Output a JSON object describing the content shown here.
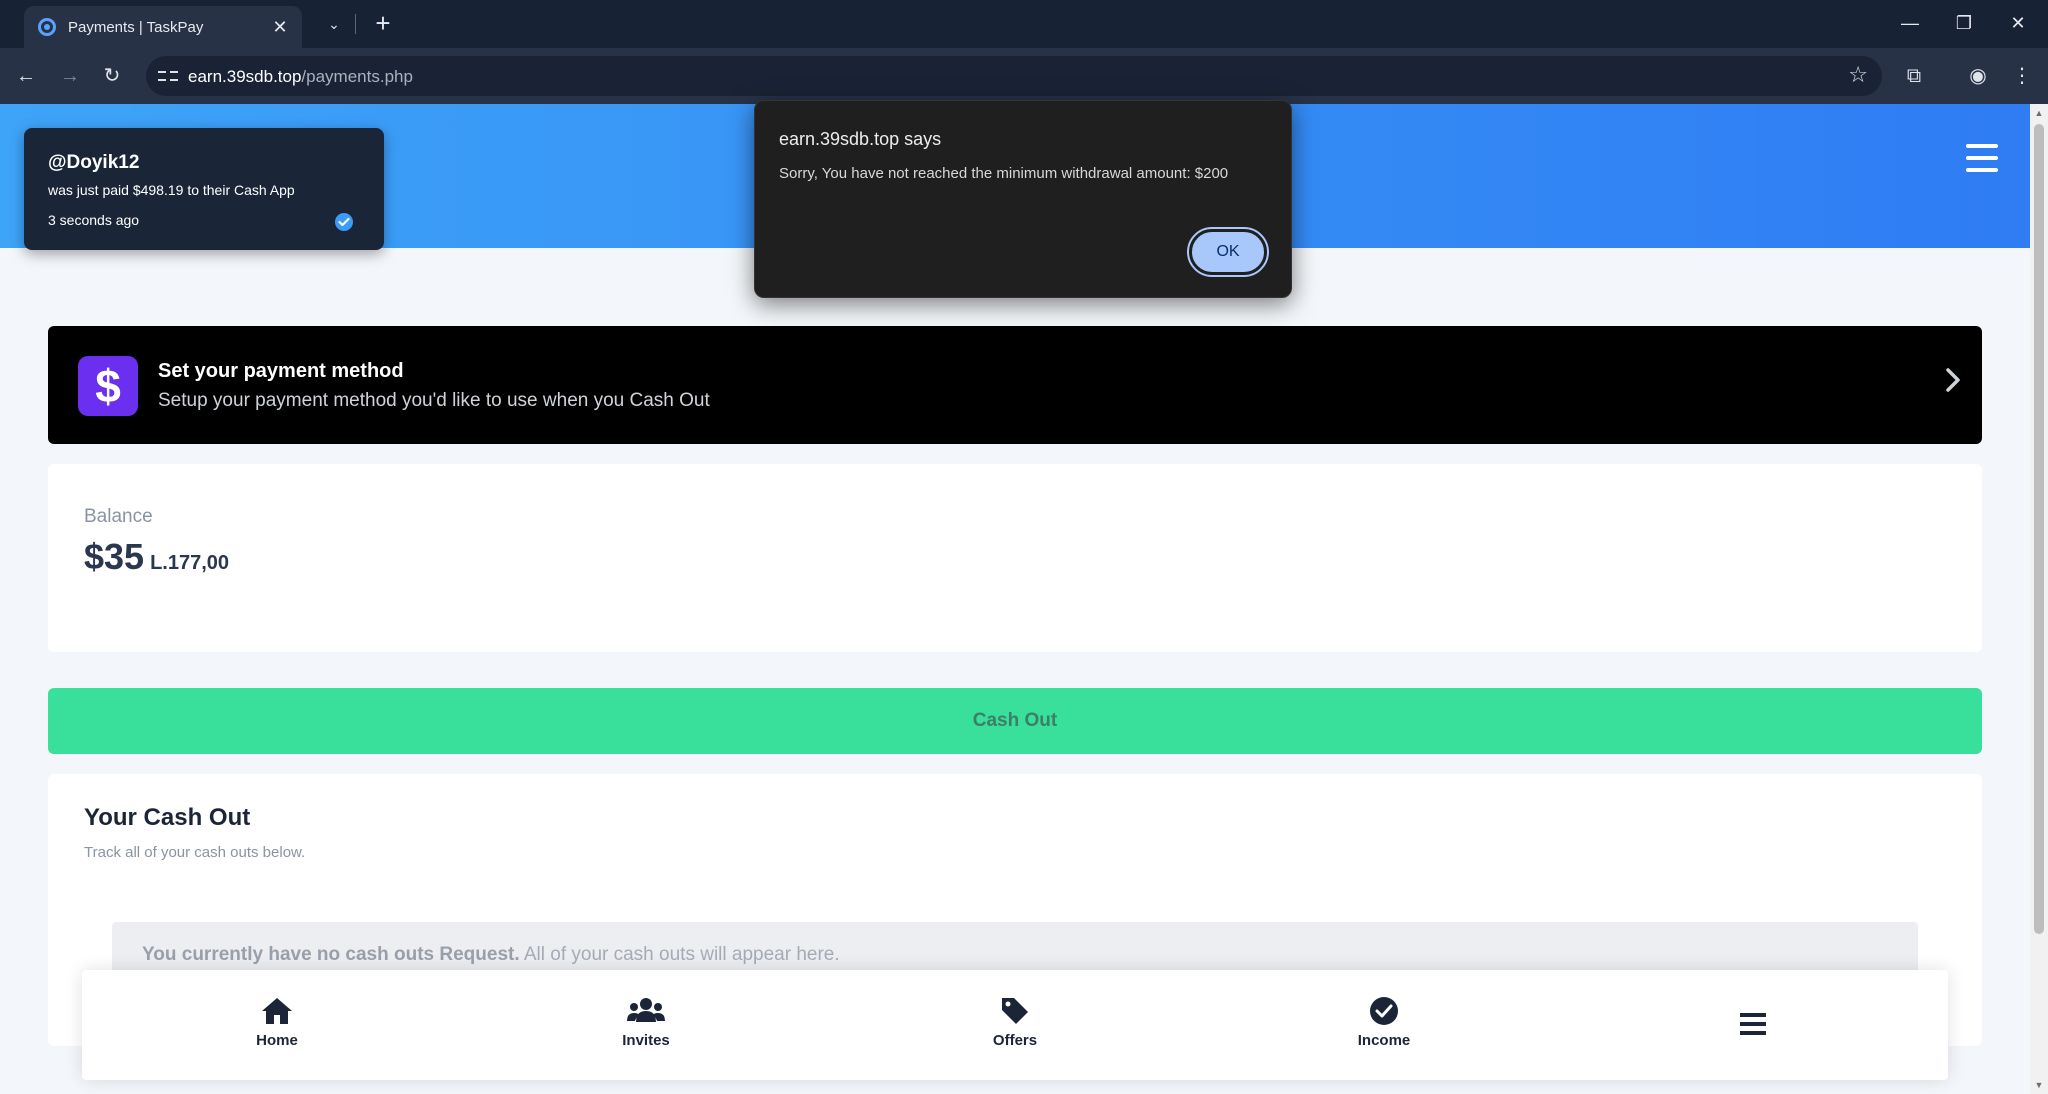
{
  "browser": {
    "tab_title": "Payments | TaskPay",
    "url_host": "earn.39sdb.top",
    "url_path": "/payments.php"
  },
  "toast": {
    "username": "@Doyik12",
    "message": "was just paid $498.19 to their Cash App",
    "time": "3 seconds ago"
  },
  "dialog": {
    "title": "earn.39sdb.top says",
    "message": "Sorry, You have not reached the minimum withdrawal amount: $200",
    "ok_label": "OK"
  },
  "payment_method": {
    "title": "Set your payment method",
    "subtitle": "Setup your payment method you'd like to use when you Cash Out",
    "icon_glyph": "$"
  },
  "balance": {
    "label": "Balance",
    "amount": "$35",
    "local_amount": "L.177,00"
  },
  "cashout": {
    "button_label": "Cash Out"
  },
  "history": {
    "title": "Your Cash Out",
    "subtitle": "Track all of your cash outs below.",
    "empty_bold": "You currently have no cash outs Request.",
    "empty_rest": " All of your cash outs will appear here."
  },
  "bottom_nav": [
    {
      "label": "Home",
      "icon": "home-icon"
    },
    {
      "label": "Invites",
      "icon": "users-icon"
    },
    {
      "label": "Offers",
      "icon": "tag-icon"
    },
    {
      "label": "Income",
      "icon": "check-circle-icon"
    },
    {
      "label": "",
      "icon": "menu-icon"
    }
  ],
  "colors": {
    "header_blue": "#2f7cf3",
    "cashout_green": "#39e09b",
    "payment_icon_purple": "#6b2ff0"
  }
}
